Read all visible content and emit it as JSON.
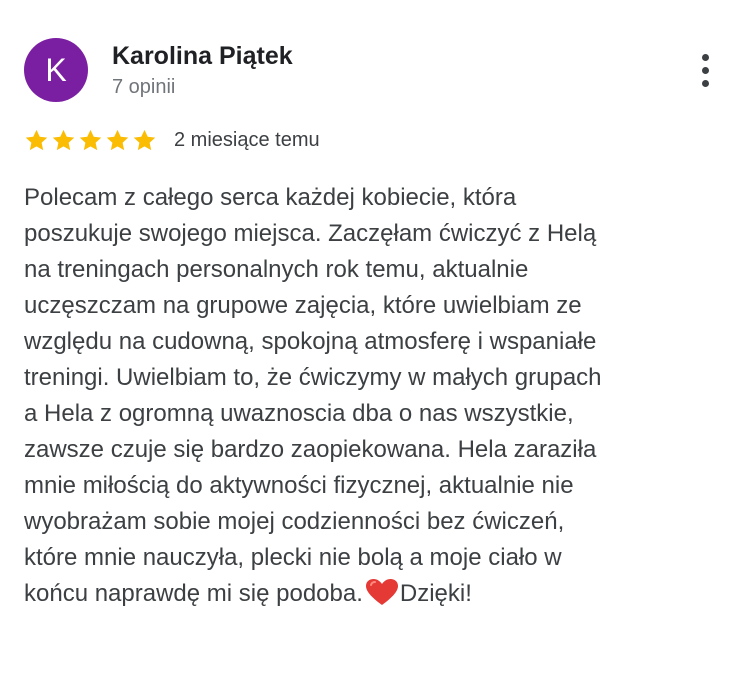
{
  "author": {
    "initial": "K",
    "name": "Karolina Piątek",
    "meta": "7 opinii",
    "avatar_color": "#7b1fa2"
  },
  "menu": {
    "icon": "more-vert-icon"
  },
  "rating": {
    "stars": 5,
    "max": 5,
    "star_color": "#fbbc04",
    "date": "2 miesiące temu"
  },
  "review": {
    "lines": [
      "Polecam z całego serca każdej kobiecie, która",
      "poszukuje swojego miejsca. Zaczęłam ćwiczyć z Helą",
      "na treningach personalnych rok temu, aktualnie",
      "uczęszczam na grupowe zajęcia, które uwielbiam ze",
      "względu na cudowną, spokojną atmosferę i wspaniałe",
      "treningi. Uwielbiam to, że ćwiczymy w małych grupach",
      "a Hela z ogromną uwaznoscia dba o nas wszystkie,",
      "zawsze czuje się bardzo zaopiekowana. Hela zaraziła",
      "mnie miłością do aktywności fizycznej, aktualnie nie",
      "wyobrażam sobie mojej codzienności bez ćwiczeń,",
      "które mnie nauczyła, plecki nie bolą a moje ciało w"
    ],
    "last_line_before": "końcu naprawdę mi się podoba.",
    "heart_icon": "red-heart-icon",
    "last_line_after": "Dzięki!"
  }
}
